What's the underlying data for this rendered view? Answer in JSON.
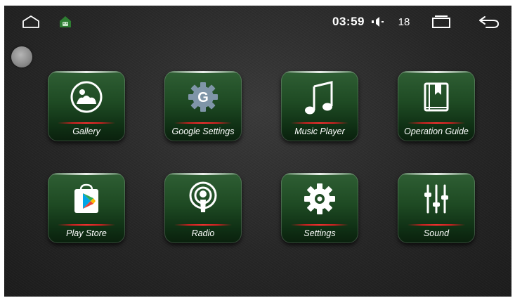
{
  "status_bar": {
    "home_icon": "home-icon",
    "android_icon": "android-home-icon",
    "time": "03:59",
    "volume_icon": "volume-icon",
    "volume_level": "18",
    "recents_icon": "recent-apps-icon",
    "back_icon": "back-icon"
  },
  "floating_button_icon": "floating-assist-ball-icon",
  "apps": [
    {
      "label": "Gallery",
      "icon": "gallery-icon"
    },
    {
      "label": "Google Settings",
      "icon": "google-settings-icon"
    },
    {
      "label": "Music Player",
      "icon": "music-note-icon"
    },
    {
      "label": "Operation Guide",
      "icon": "book-icon"
    },
    {
      "label": "Play Store",
      "icon": "play-store-icon"
    },
    {
      "label": "Radio",
      "icon": "podcast-radio-icon"
    },
    {
      "label": "Settings",
      "icon": "gear-icon"
    },
    {
      "label": "Sound",
      "icon": "equalizer-sliders-icon"
    }
  ],
  "colors": {
    "tile_green": "#1e4a23",
    "accent_red": "#e02020",
    "background": "#262626"
  }
}
